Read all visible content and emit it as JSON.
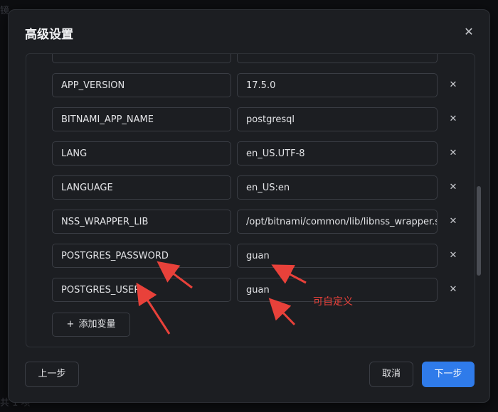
{
  "dialog": {
    "title": "高级设置",
    "close_icon": "close-icon"
  },
  "env_vars": [
    {
      "key": "",
      "value": ""
    },
    {
      "key": "APP_VERSION",
      "value": "17.5.0"
    },
    {
      "key": "BITNAMI_APP_NAME",
      "value": "postgresql"
    },
    {
      "key": "LANG",
      "value": "en_US.UTF-8"
    },
    {
      "key": "LANGUAGE",
      "value": "en_US:en"
    },
    {
      "key": "NSS_WRAPPER_LIB",
      "value": "/opt/bitnami/common/lib/libnss_wrapper.so"
    },
    {
      "key": "POSTGRES_PASSWORD",
      "value": "guan"
    },
    {
      "key": "POSTGRES_USER",
      "value": "guan"
    }
  ],
  "add_button_label": "添加变量",
  "footer": {
    "prev_label": "上一步",
    "cancel_label": "取消",
    "next_label": "下一步"
  },
  "annotation": {
    "text": "可自定义",
    "color": "#e8413a"
  },
  "colors": {
    "accent": "#2f7bea"
  }
}
